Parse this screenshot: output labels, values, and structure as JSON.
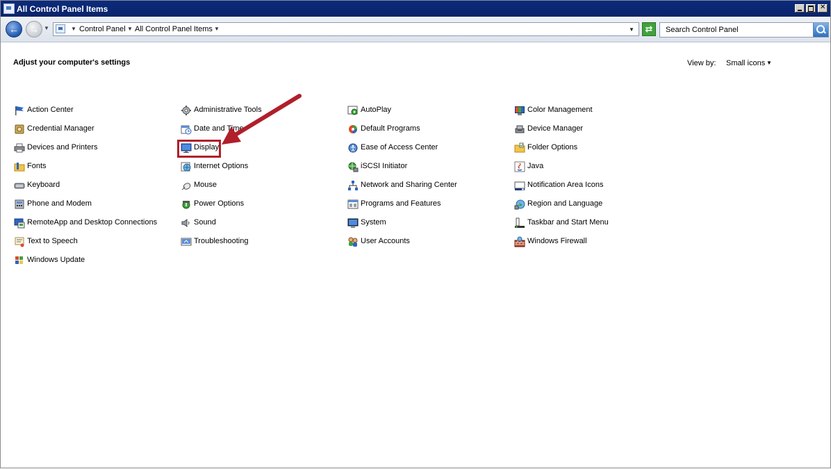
{
  "window": {
    "title": "All Control Panel Items"
  },
  "nav": {
    "breadcrumbs": [
      "Control Panel",
      "All Control Panel Items"
    ],
    "search_placeholder": "Search Control Panel"
  },
  "main": {
    "heading": "Adjust your computer's settings",
    "view_by_label": "View by:",
    "view_by_value": "Small icons"
  },
  "items": [
    {
      "label": "Action Center",
      "icon": "flag-icon"
    },
    {
      "label": "Credential Manager",
      "icon": "credential-vault-icon"
    },
    {
      "label": "Devices and Printers",
      "icon": "printer-icon"
    },
    {
      "label": "Fonts",
      "icon": "fonts-folder-icon"
    },
    {
      "label": "Keyboard",
      "icon": "keyboard-icon"
    },
    {
      "label": "Phone and Modem",
      "icon": "phone-icon"
    },
    {
      "label": "RemoteApp and Desktop Connections",
      "icon": "remote-desktop-icon"
    },
    {
      "label": "Text to Speech",
      "icon": "speech-icon"
    },
    {
      "label": "Windows Update",
      "icon": "windows-update-icon"
    },
    {
      "label": "Administrative Tools",
      "icon": "admin-tools-icon"
    },
    {
      "label": "Date and Time",
      "icon": "calendar-clock-icon"
    },
    {
      "label": "Display",
      "icon": "monitor-icon"
    },
    {
      "label": "Internet Options",
      "icon": "globe-icon"
    },
    {
      "label": "Mouse",
      "icon": "mouse-icon"
    },
    {
      "label": "Power Options",
      "icon": "battery-icon"
    },
    {
      "label": "Sound",
      "icon": "speaker-icon"
    },
    {
      "label": "Troubleshooting",
      "icon": "troubleshoot-icon"
    },
    {
      "label": "AutoPlay",
      "icon": "autoplay-icon"
    },
    {
      "label": "Default Programs",
      "icon": "default-programs-icon"
    },
    {
      "label": "Ease of Access Center",
      "icon": "ease-of-access-icon"
    },
    {
      "label": "iSCSI Initiator",
      "icon": "iscsi-globe-icon"
    },
    {
      "label": "Network and Sharing Center",
      "icon": "network-icon"
    },
    {
      "label": "Programs and Features",
      "icon": "programs-icon"
    },
    {
      "label": "System",
      "icon": "system-monitor-icon"
    },
    {
      "label": "User Accounts",
      "icon": "users-icon"
    },
    {
      "label": "Color Management",
      "icon": "color-monitor-icon"
    },
    {
      "label": "Device Manager",
      "icon": "device-manager-icon"
    },
    {
      "label": "Folder Options",
      "icon": "folder-icon"
    },
    {
      "label": "Java",
      "icon": "java-icon"
    },
    {
      "label": "Notification Area Icons",
      "icon": "notification-icon"
    },
    {
      "label": "Region and Language",
      "icon": "region-globe-icon"
    },
    {
      "label": "Taskbar and Start Menu",
      "icon": "taskbar-icon"
    },
    {
      "label": "Windows Firewall",
      "icon": "firewall-icon"
    }
  ],
  "colors": {
    "titlebar": "#0a246a",
    "annotation_red": "#b01f2b"
  }
}
